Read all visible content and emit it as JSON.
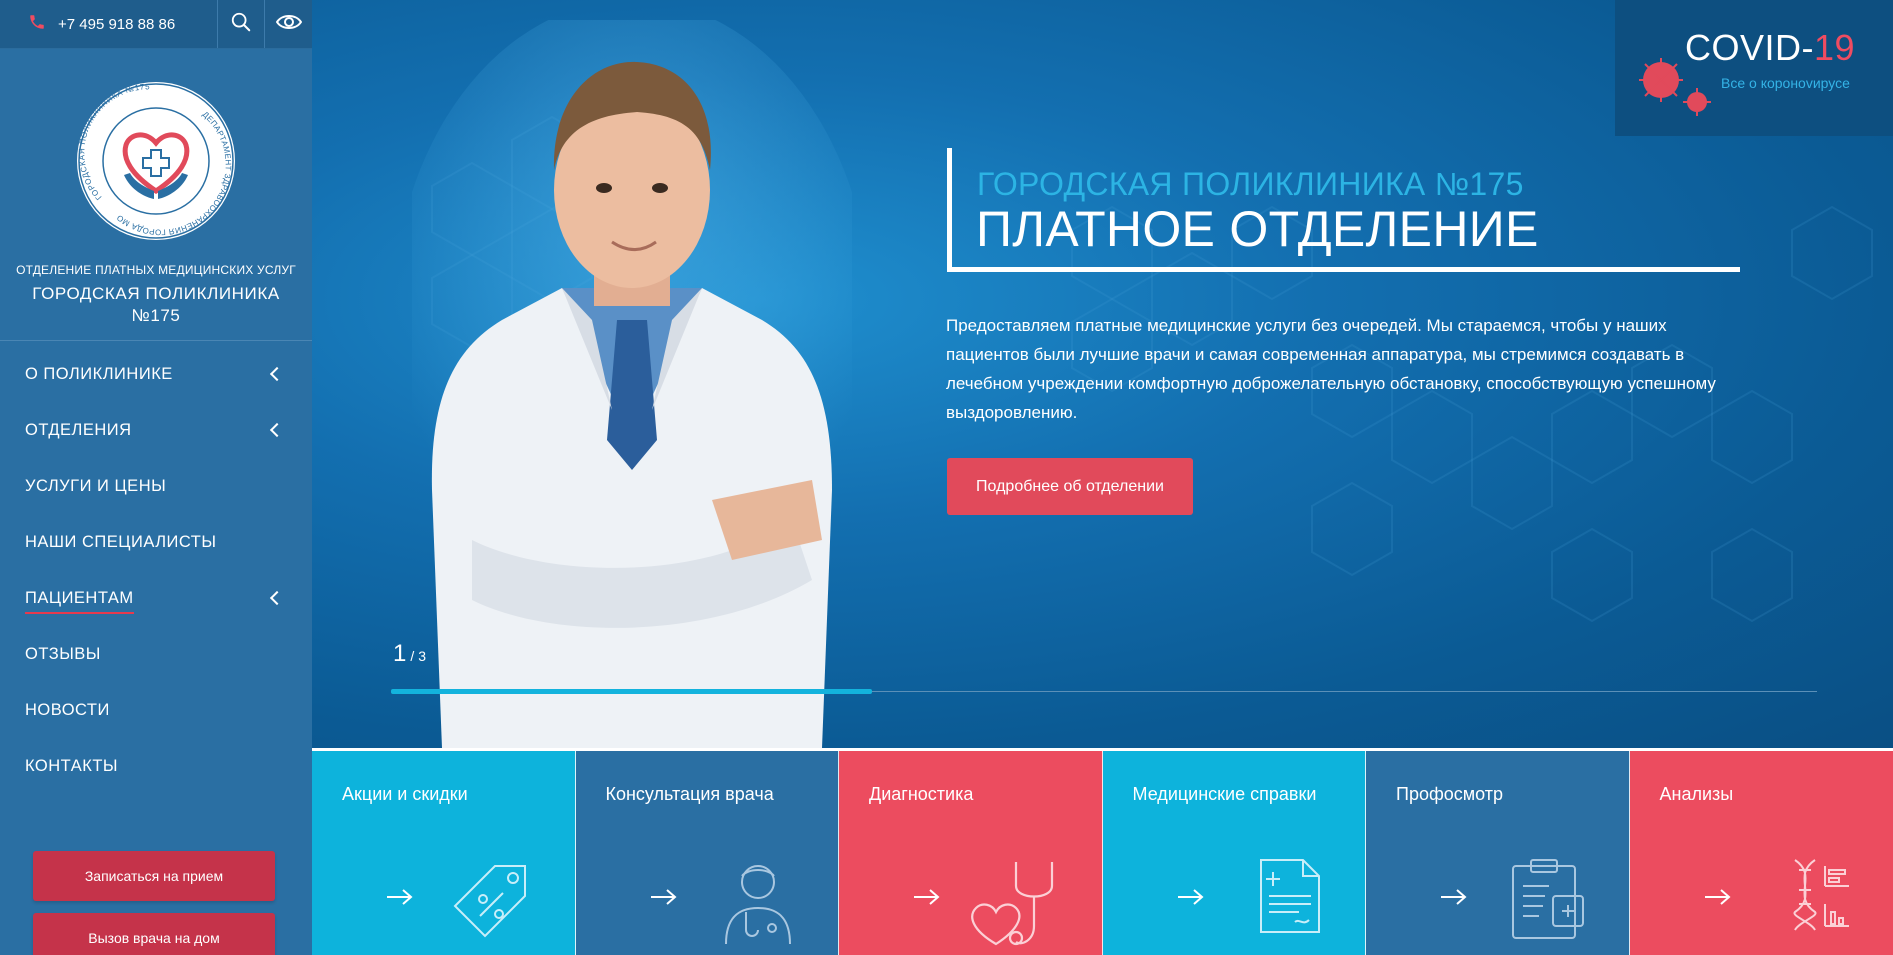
{
  "topbar": {
    "phone": "+7 495 918 88 86"
  },
  "logo": {
    "ring_text_left": "ГОРОДСКАЯ ПОЛИКЛИНИКА №175",
    "ring_text_right": "ДЕПАРТАМЕНТ ЗДРАВООХРАНЕНИЯ ГОРОДА МОСКВЫ",
    "top_line": "ОТДЕЛЕНИЕ ПЛАТНЫХ МЕДИЦИНСКИХ УСЛУГ",
    "name": "ГОРОДСКАЯ ПОЛИКЛИНИКА №175"
  },
  "menu": [
    {
      "label": "О ПОЛИКЛИНИКЕ",
      "has_sub": true,
      "active": false
    },
    {
      "label": "ОТДЕЛЕНИЯ",
      "has_sub": true,
      "active": false
    },
    {
      "label": "УСЛУГИ И ЦЕНЫ",
      "has_sub": false,
      "active": false
    },
    {
      "label": "НАШИ СПЕЦИАЛИСТЫ",
      "has_sub": false,
      "active": false
    },
    {
      "label": "ПАЦИЕНТАМ",
      "has_sub": true,
      "active": true
    },
    {
      "label": "ОТЗЫВЫ",
      "has_sub": false,
      "active": false
    },
    {
      "label": "НОВОСТИ",
      "has_sub": false,
      "active": false
    },
    {
      "label": "КОНТАКТЫ",
      "has_sub": false,
      "active": false
    }
  ],
  "sidebar_buttons": {
    "appointment": "Записаться на прием",
    "home_call": "Вызов врача на дом"
  },
  "covid": {
    "title_main": "COVID-",
    "title_num": "19",
    "subtitle": "Все о коронovирусе"
  },
  "hero": {
    "subtitle": "ГОРОДСКАЯ ПОЛИКЛИНИКА №175",
    "title": "ПЛАТНОЕ ОТДЕЛЕНИЕ",
    "text": "Предоставляем платные медицинские услуги без очередей. Мы стараемся, чтобы у наших пациентов были лучшие врачи и самая современная аппаратура, мы стремимся создавать в лечебном учреждении комфортную доброжелательную обстановку, способствующую успешному выздоровлению.",
    "button": "Подробнее об отделении",
    "slide_current": "1",
    "slide_sep": "/",
    "slide_total": "3",
    "progress": 0.337
  },
  "tiles": [
    {
      "label": "Акции и скидки",
      "icon": "discount-tag-icon",
      "color": "#0db3dc"
    },
    {
      "label": "Консультация врача",
      "icon": "doctor-icon",
      "color": "#2a6fa3"
    },
    {
      "label": "Диагностика",
      "icon": "stethoscope-icon",
      "color": "#ec4c5f"
    },
    {
      "label": "Медицинские справки",
      "icon": "medical-document-icon",
      "color": "#0db3dc"
    },
    {
      "label": "Профосмотр",
      "icon": "clipboard-icon",
      "color": "#2a6fa3"
    },
    {
      "label": "Анализы",
      "icon": "dna-analysis-icon",
      "color": "#ec4c5f"
    }
  ],
  "colors": {
    "sidebar": "#2a6fa3",
    "accent_red": "#e14a5b",
    "accent_cyan": "#2cb4e4"
  }
}
